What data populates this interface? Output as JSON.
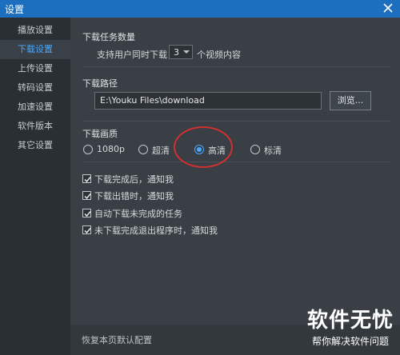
{
  "window": {
    "title": "设置"
  },
  "sidebar": {
    "items": [
      {
        "label": "播放设置"
      },
      {
        "label": "下载设置",
        "active": true
      },
      {
        "label": "上传设置"
      },
      {
        "label": "转码设置"
      },
      {
        "label": "加速设置"
      },
      {
        "label": "软件版本"
      },
      {
        "label": "其它设置"
      }
    ]
  },
  "download": {
    "tasks_title": "下载任务数量",
    "tasks_prefix": "支持用户同时下载",
    "tasks_value": "3",
    "tasks_suffix": "个视频内容",
    "path_title": "下载路径",
    "path_value": "E:\\Youku Files\\download",
    "browse_label": "浏览...",
    "quality_title": "下载画质",
    "quality_options": [
      {
        "label": "1080p",
        "checked": false
      },
      {
        "label": "超清",
        "checked": false
      },
      {
        "label": "高清",
        "checked": true
      },
      {
        "label": "标清",
        "checked": false
      }
    ],
    "checkboxes": [
      {
        "label": "下载完成后，通知我",
        "checked": true
      },
      {
        "label": "下载出错时，通知我",
        "checked": true
      },
      {
        "label": "自动下载未完成的任务",
        "checked": true
      },
      {
        "label": "未下载完成退出程序时，通知我",
        "checked": true
      }
    ]
  },
  "footer": {
    "restore_label": "恢复本页默认配置"
  },
  "watermark": {
    "line1": "软件无忧",
    "line2": "帮你解决软件问题"
  },
  "colors": {
    "titlebar": "#1c6fbe",
    "accent": "#49a8ff",
    "annotation": "#d0302f"
  }
}
